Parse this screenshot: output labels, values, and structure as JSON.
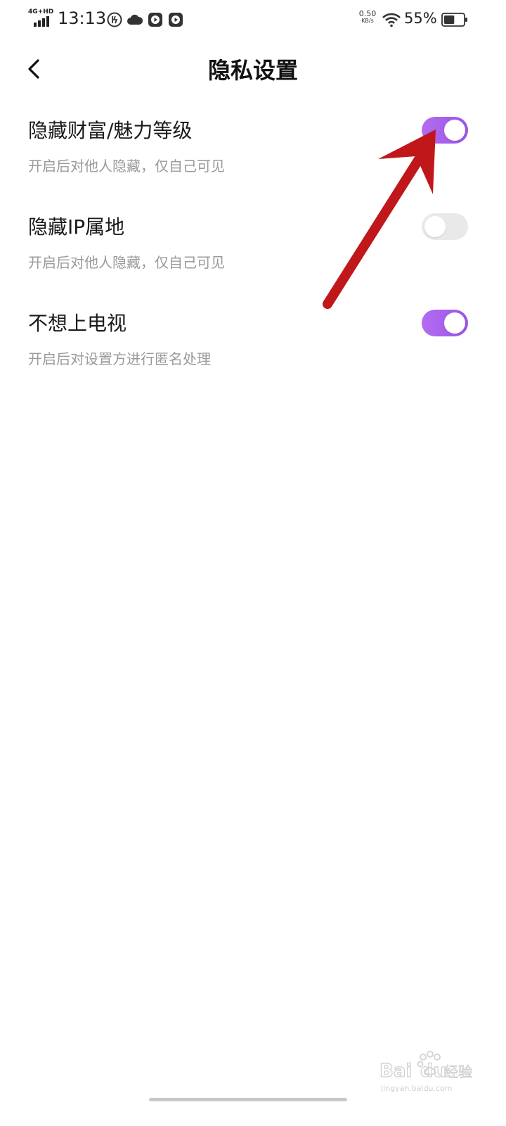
{
  "status_bar": {
    "network": "4G+HD",
    "time": "13:13",
    "speed_value": "0.50",
    "speed_unit": "KB/s",
    "battery_percent": "55%",
    "battery_level": 0.55,
    "icons": [
      "speed-boost-icon",
      "cloud-icon",
      "media-play-icon",
      "media-play-icon"
    ]
  },
  "header": {
    "title": "隐私设置",
    "back_icon": "chevron-left-icon"
  },
  "settings": [
    {
      "title": "隐藏财富/魅力等级",
      "description": "开启后对他人隐藏，仅自己可见",
      "enabled": true
    },
    {
      "title": "隐藏IP属地",
      "description": "开启后对他人隐藏，仅自己可见",
      "enabled": false
    },
    {
      "title": "不想上电视",
      "description": "开启后对设置方进行匿名处理",
      "enabled": true
    }
  ],
  "colors": {
    "toggle_on": "#a862ec",
    "toggle_off": "#e9e9e9",
    "annotation_arrow": "#c0171a"
  },
  "watermark": {
    "brand": "Bai du 经验",
    "url": "jingyan.baidu.com"
  }
}
